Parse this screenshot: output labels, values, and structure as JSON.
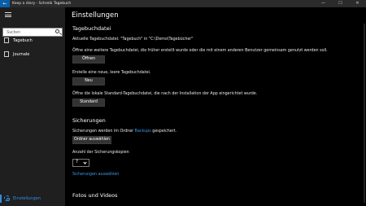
{
  "titlebar": {
    "back_glyph": "←",
    "title": "Keep a diary - Schreib Tagebuch",
    "minimize": "—",
    "maximize": "☐",
    "close": "✕"
  },
  "sidebar": {
    "search_placeholder": "Suchen",
    "items": [
      {
        "label": "Tagebuch",
        "icon": "book-icon"
      },
      {
        "label": "Journale",
        "icon": "journal-icon"
      }
    ],
    "settings_label": "Einstellungen"
  },
  "main": {
    "title": "Einstellungen",
    "diary": {
      "heading": "Tagebuchdatei",
      "current": "Aktuelle Tagebuchdatei: \"Tagebuch\" in \"C:\\Demo\\Tagebücher\"",
      "open_desc": "Öffne eine weitere Tagebuchdatei, die früher erstellt wurde oder die mit einem anderen Benutzer gemeinsam genutzt werden soll.",
      "open_button": "Öffnen",
      "new_desc": "Erstelle eine neue, leere Tagebuchdatei.",
      "new_button": "Neu",
      "standard_desc": "Öffne die lokale Standard-Tagebuchdatei, die nach der Installation der App eingerichtet wurde.",
      "standard_button": "Standard"
    },
    "backups": {
      "heading": "Sicherungen",
      "saved_prefix": "Sicherungen werden im Ordner ",
      "saved_link": "Backups",
      "saved_suffix": " gespeichert.",
      "choose_folder_button": "Ordner auswählen",
      "count_label": "Anzahl der Sicherungskopien",
      "count_value": "7",
      "select_link": "Sicherungen auswählen"
    },
    "photos": {
      "heading": "Fotos und Videos"
    }
  },
  "colors": {
    "accent": "#2f8fe5",
    "link": "#3b9be8",
    "sidebar_bg": "#1f1f1f",
    "main_bg": "#000000",
    "button_bg": "#333333"
  }
}
